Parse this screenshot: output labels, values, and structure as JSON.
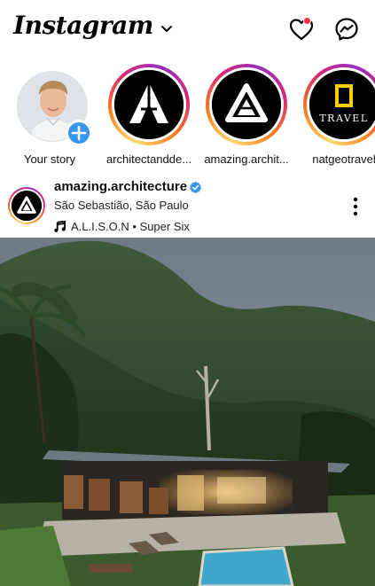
{
  "header": {
    "app_name": "Instagram",
    "icons": {
      "dropdown": "chevron-down-icon",
      "activity": "heart-icon",
      "messages": "messenger-icon"
    },
    "colors": {
      "notification_dot": "#ff3040"
    }
  },
  "stories": {
    "items": [
      {
        "label": "Your story",
        "type": "own",
        "badge_icon": "plus-icon",
        "badge_color": "#3797f0"
      },
      {
        "label": "architectandde...",
        "type": "ring"
      },
      {
        "label": "amazing.archit...",
        "type": "ring"
      },
      {
        "label": "natgeotravel",
        "type": "ring",
        "logo_text": "TRAVEL",
        "logo_color": "#ffce00"
      }
    ]
  },
  "post": {
    "username": "amazing.architecture",
    "verified": true,
    "location": "São Sebastião, São Paulo",
    "music": "A.L.I.S.O.N • Super Six",
    "icons": {
      "verified": "verified-badge-icon",
      "music": "music-note-icon",
      "more": "more-options-icon"
    },
    "colors": {
      "verified": "#3797f0"
    }
  }
}
